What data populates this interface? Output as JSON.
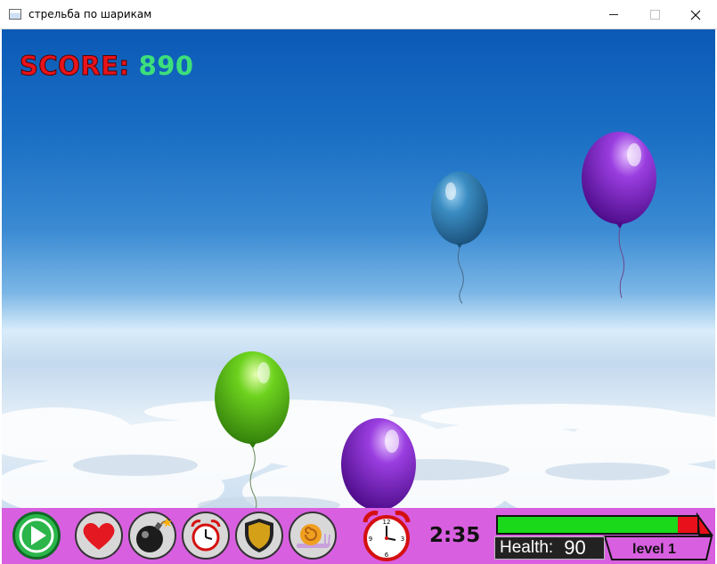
{
  "window": {
    "title": "стрельба по шарикам",
    "minimize": "—",
    "maximize": "☐",
    "close": "✕"
  },
  "hud": {
    "score_label": "SCORE:",
    "score_value": "890",
    "timer": "2:35",
    "health_label": "Health:",
    "health_value": "90",
    "health_fraction": 0.9,
    "level": "level 1"
  },
  "balloons": [
    {
      "color": "blue",
      "hex": "#2e7fb3"
    },
    {
      "color": "purple",
      "hex": "#7a1fc0"
    },
    {
      "color": "green",
      "hex": "#5cc21a"
    },
    {
      "color": "purple",
      "hex": "#7a1fc0"
    }
  ],
  "toolbar": {
    "items": [
      {
        "name": "play-icon"
      },
      {
        "name": "heart-icon"
      },
      {
        "name": "bomb-icon"
      },
      {
        "name": "alarm-clock-icon"
      },
      {
        "name": "shield-icon"
      },
      {
        "name": "snail-icon"
      }
    ]
  },
  "colors": {
    "toolbar_bg": "#d85fe0",
    "score_label": "#e8141b",
    "score_value": "#3ddf7b",
    "health_good": "#1ad81a",
    "health_bad": "#e8101a"
  }
}
